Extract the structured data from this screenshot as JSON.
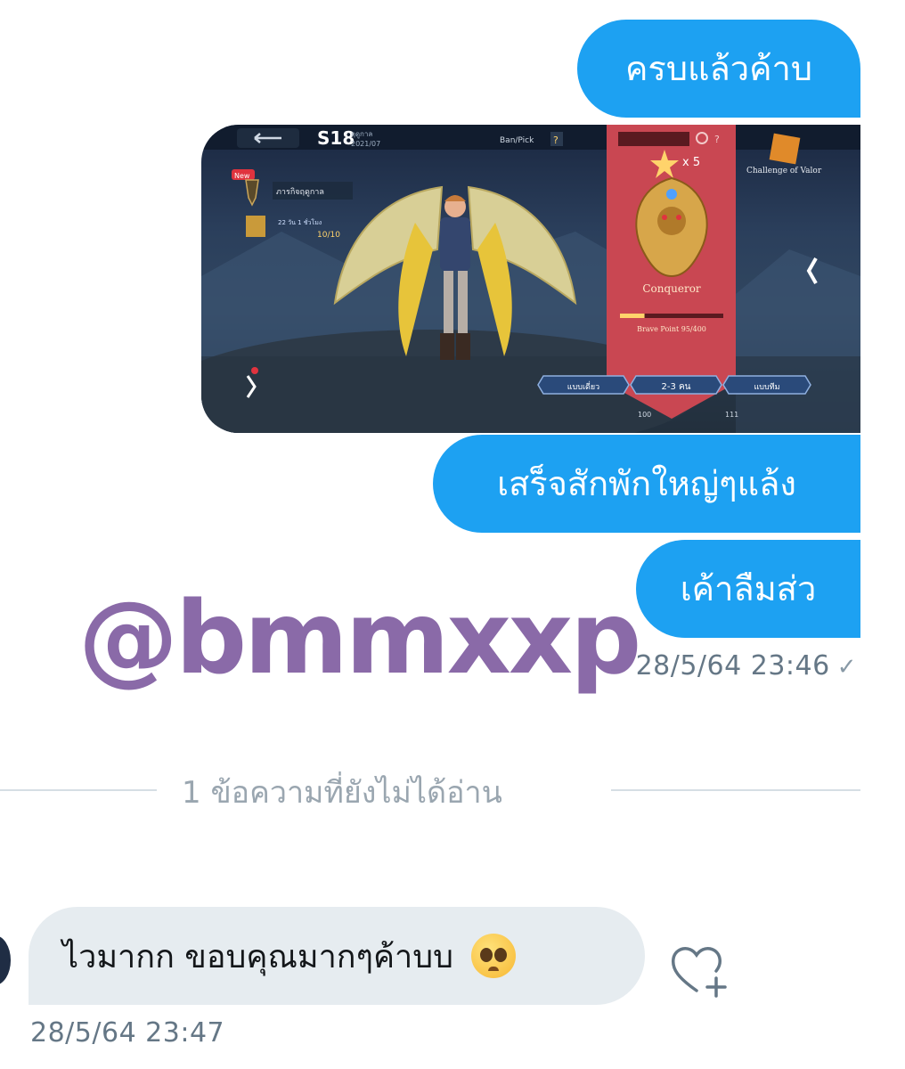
{
  "messages": {
    "out1": "ครบแล้วค้าบ",
    "out2": "เสร็จสักพักใหญ่ๆแล้ง",
    "out3": "เค้าลืมส่ว",
    "out_timestamp": "28/5/64 23:46",
    "out_status_icon": "check-icon",
    "in1": "ไวมากก ขอบคุณมากๆค้าบบ",
    "in_emoji": "pleading-face-emoji",
    "in_timestamp": "28/5/64 23:47"
  },
  "watermark": "@bmmxxp",
  "divider": "1 ข้อความที่ยังไม่ได้อ่าน",
  "game": {
    "season": "S18",
    "season_label": "ฤดูกาล",
    "season_date": "2021/07",
    "ban_pick": "Ban/Pick",
    "new_badge": "New",
    "mission_label": "ภารกิจฤดูกาล",
    "event_time": "22 วัน 1 ชั่วโมง",
    "event_progress": "10/10",
    "rank_count": "x 5",
    "rank_name": "Conqueror",
    "brave_points": "Brave Point 95/400",
    "challenge_label": "Challenge of Valor",
    "mode_buttons": [
      "แบบเดี่ยว",
      "2-3 คน",
      "แบบทีม"
    ],
    "stat1": "100",
    "stat2": "111",
    "brave_fill": 0.2375
  },
  "colors": {
    "outgoing_bubble": "#1da1f2",
    "incoming_bubble": "#e6ecf0",
    "watermark": "#8a6aa8"
  }
}
